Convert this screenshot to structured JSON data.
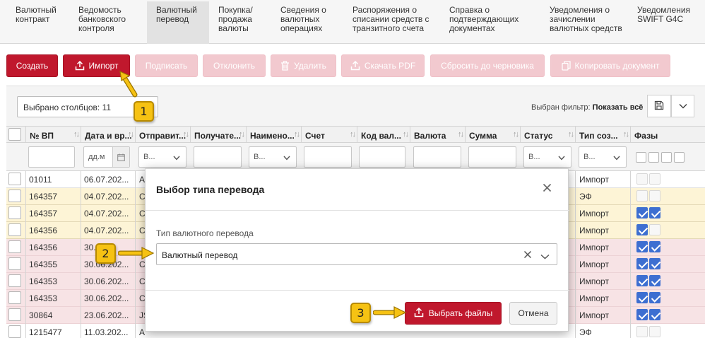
{
  "tabs": [
    {
      "label": "Валютный\nконтракт",
      "active": false
    },
    {
      "label": "Ведомость\nбанковского\nконтроля",
      "active": false
    },
    {
      "label": "Валютный\nперевод",
      "active": true
    },
    {
      "label": "Покупка/\nпродажа\nвалюты",
      "active": false
    },
    {
      "label": "Сведения о\nвалютных\nоперациях",
      "active": false
    },
    {
      "label": "Распоряжения о\nсписании средств с\nтранзитного счета",
      "active": false
    },
    {
      "label": "Справка о\nподтверждающих\nдокументах",
      "active": false
    },
    {
      "label": "Уведомления о\nзачислении\nвалютных средств",
      "active": false
    },
    {
      "label": "Уведомления\nSWIFT G4C",
      "active": false
    }
  ],
  "toolbar": {
    "create": "Создать",
    "import": "Импорт",
    "sign": "Подписать",
    "reject": "Отклонить",
    "delete": "Удалить",
    "download_pdf": "Скачать PDF",
    "reset_draft": "Сбросить до черновика",
    "copy_document": "Копировать документ"
  },
  "grid": {
    "columns_selected": "Выбрано столбцов: 11",
    "filter_label": "Выбран фильтр:",
    "filter_value": "Показать всё",
    "headers": [
      "№ ВП",
      "Дата и вр...",
      "Отправит...",
      "Получате...",
      "Наимено...",
      "Счет",
      "Код вал...",
      "Валюта",
      "Сумма",
      "Статус",
      "Тип соз...",
      "Фазы"
    ],
    "filters": {
      "date_placeholder": "дд.м",
      "select_placeholder": "В..."
    },
    "rows": [
      {
        "num": "01011",
        "date": "06.07.202...",
        "sender": "А",
        "type": "Импорт",
        "color": "white",
        "phases": [
          false,
          false
        ]
      },
      {
        "num": "164357",
        "date": "04.07.202...",
        "sender": "С",
        "type": "ЭФ",
        "color": "yellow",
        "phases": [
          false,
          false
        ]
      },
      {
        "num": "164357",
        "date": "04.07.202...",
        "sender": "С",
        "type": "Импорт",
        "color": "yellow",
        "phases": [
          true,
          true
        ]
      },
      {
        "num": "164356",
        "date": "04.07.202...",
        "sender": "С",
        "type": "Импорт",
        "color": "yellow",
        "phases": [
          true,
          false
        ]
      },
      {
        "num": "164356",
        "date": "30.0",
        "sender": "",
        "type": "Импорт",
        "color": "pink",
        "phases": [
          true,
          true
        ]
      },
      {
        "num": "164355",
        "date": "30.06.202...",
        "sender": "С",
        "type": "Импорт",
        "color": "pink",
        "phases": [
          true,
          true
        ]
      },
      {
        "num": "164353",
        "date": "30.06.202...",
        "sender": "С",
        "type": "Импорт",
        "color": "pink",
        "phases": [
          true,
          true
        ]
      },
      {
        "num": "164353",
        "date": "30.06.202...",
        "sender": "С",
        "type": "Импорт",
        "color": "pink",
        "phases": [
          true,
          true
        ]
      },
      {
        "num": "30864",
        "date": "23.06.202...",
        "sender": "JS",
        "type": "Импорт",
        "color": "pink",
        "phases": [
          true,
          true
        ]
      },
      {
        "num": "1215477",
        "date": "11.03.202...",
        "sender": "А",
        "type": "ЭФ",
        "color": "white",
        "phases": [
          false,
          false
        ]
      }
    ]
  },
  "modal": {
    "title": "Выбор типа перевода",
    "field_label": "Тип валютного перевода",
    "field_value": "Валютный перевод",
    "choose_files": "Выбрать файлы",
    "cancel": "Отмена"
  },
  "callouts": [
    "1",
    "2",
    "3"
  ],
  "colors": {
    "brand_red": "#c0182d",
    "callout_yellow": "#f6c213",
    "checked_blue": "#3d6fd1"
  }
}
